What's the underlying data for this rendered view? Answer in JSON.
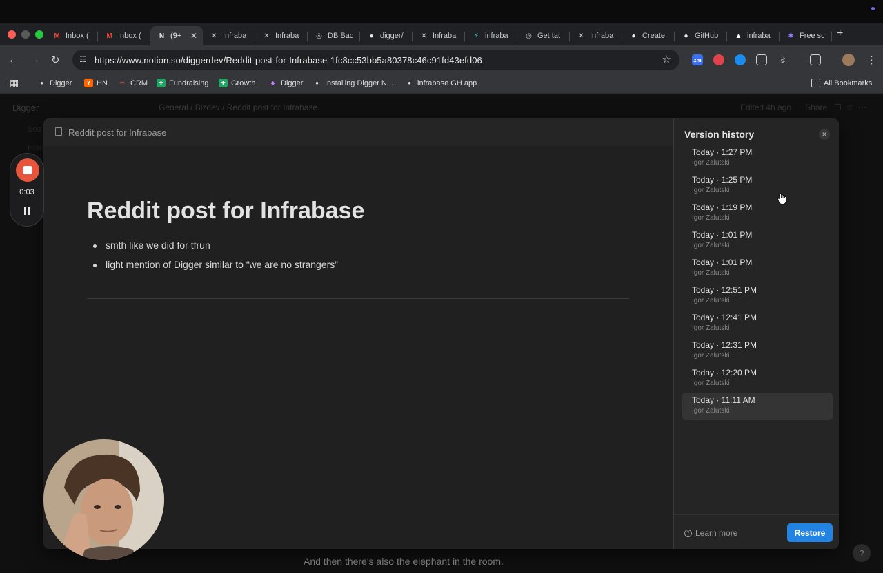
{
  "browser": {
    "tabs": [
      {
        "label": "Inbox (",
        "icon": "gmail-icon"
      },
      {
        "label": "Inbox (",
        "icon": "gmail-icon"
      },
      {
        "label": "(9+",
        "icon": "notion-icon",
        "active": true
      },
      {
        "label": "Infraba",
        "icon": "infrabase-icon"
      },
      {
        "label": "Infraba",
        "icon": "infrabase-icon"
      },
      {
        "label": "DB Bac",
        "icon": "openai-icon"
      },
      {
        "label": "digger/",
        "icon": "github-icon"
      },
      {
        "label": "Infraba",
        "icon": "infrabase-icon"
      },
      {
        "label": "infraba",
        "icon": "bolt-icon"
      },
      {
        "label": "Get tat",
        "icon": "openai-icon"
      },
      {
        "label": "Infraba",
        "icon": "infrabase-icon"
      },
      {
        "label": "Create",
        "icon": "github-icon"
      },
      {
        "label": "GitHub",
        "icon": "github-icon"
      },
      {
        "label": "infraba",
        "icon": "vercel-icon"
      },
      {
        "label": "Free sc",
        "icon": "gear-icon"
      }
    ],
    "url": "https://www.notion.so/diggerdev/Reddit-post-for-Infrabase-1fc8cc53bb5a80378c46c91fd43efd06",
    "bookmarks": [
      {
        "label": "Digger",
        "icon": "github-icon"
      },
      {
        "label": "HN",
        "icon": "hn-icon"
      },
      {
        "label": "CRM",
        "icon": "crm-icon"
      },
      {
        "label": "Fundraising",
        "icon": "sheet-icon"
      },
      {
        "label": "Growth",
        "icon": "sheet-icon"
      },
      {
        "label": "Digger",
        "icon": "digger-icon"
      },
      {
        "label": "Installing Digger N...",
        "icon": "github-icon"
      },
      {
        "label": "infrabase GH app",
        "icon": "github-icon"
      }
    ],
    "all_bookmarks": "All Bookmarks"
  },
  "notion": {
    "workspace": "Digger",
    "breadcrumbs": [
      "General",
      "Bizdev",
      "Reddit post for Infrabase"
    ],
    "edited": "Edited 4h ago",
    "share": "Share",
    "search": "Sea",
    "home": "Hom"
  },
  "modal": {
    "page_label": "Reddit post for Infrabase",
    "title": "Reddit post for Infrabase",
    "bullets": [
      "smth like we did for tfrun",
      "light mention of Digger similar to “we are no strangers”"
    ]
  },
  "version_history": {
    "title": "Version history",
    "versions": [
      {
        "time": "Today · 1:27 PM",
        "author": "Igor Zalutski"
      },
      {
        "time": "Today · 1:25 PM",
        "author": "Igor Zalutski"
      },
      {
        "time": "Today · 1:19 PM",
        "author": "Igor Zalutski"
      },
      {
        "time": "Today · 1:01 PM",
        "author": "Igor Zalutski"
      },
      {
        "time": "Today · 1:01 PM",
        "author": "Igor Zalutski"
      },
      {
        "time": "Today · 12:51 PM",
        "author": "Igor Zalutski"
      },
      {
        "time": "Today · 12:41 PM",
        "author": "Igor Zalutski"
      },
      {
        "time": "Today · 12:31 PM",
        "author": "Igor Zalutski"
      },
      {
        "time": "Today · 12:20 PM",
        "author": "Igor Zalutski"
      },
      {
        "time": "Today · 11:11 AM",
        "author": "Igor Zalutski",
        "selected": true
      }
    ],
    "learn_more": "Learn more",
    "restore": "Restore"
  },
  "recorder": {
    "elapsed": "0:03"
  },
  "caption": "And then there's also the elephant in the room.",
  "colors": {
    "accent": "#2383e2",
    "record": "#e5563c",
    "background": "#191919"
  }
}
